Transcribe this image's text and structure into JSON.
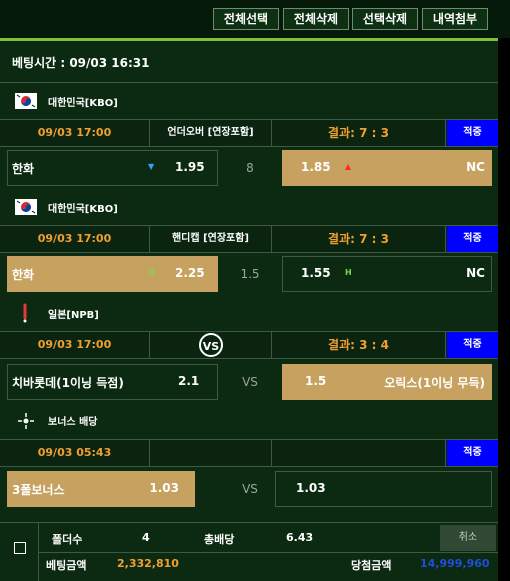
{
  "toolbar": {
    "select_all": "전체선택",
    "delete_all": "전체삭제",
    "delete_selected": "선택삭제",
    "attach_history": "내역첨부"
  },
  "bet_time": "베팅시간 : 09/03 16:31",
  "bets": [
    {
      "league": "대한민국[KBO]",
      "date": "09/03 17:00",
      "market": "언더오버 [연장포함]",
      "result": "결과: 7 : 3",
      "status": "적중",
      "home_team": "한화",
      "home_odds": "1.95",
      "home_mark": "▼",
      "mid": "8",
      "away_odds": "1.85",
      "away_mark": "▲",
      "away_team": "NC"
    },
    {
      "league": "대한민국[KBO]",
      "date": "09/03 17:00",
      "market": "핸디캡 [연장포함]",
      "result": "결과: 7 : 3",
      "status": "적중",
      "home_team": "한화",
      "home_odds": "2.25",
      "home_mark": "H",
      "mid": "1.5",
      "away_odds": "1.55",
      "away_mark": "H",
      "away_team": "NC"
    },
    {
      "league": "일본[NPB]",
      "date": "09/03 17:00",
      "market": "",
      "result": "결과: 3 : 4",
      "status": "적중",
      "home_team": "치바롯데(1이닝 득점)",
      "home_odds": "2.1",
      "mid": "VS",
      "away_odds": "1.5",
      "away_team": "오릭스(1이닝 무득)"
    },
    {
      "league": "보너스 배당",
      "date": "09/03 05:43",
      "market": "",
      "result": "",
      "status": "적중",
      "home_team": "3폴보너스",
      "home_odds": "1.03",
      "mid": "VS",
      "away_odds": "1.03",
      "away_team": ""
    }
  ],
  "footer": {
    "folder_label": "폴더수",
    "folder_value": "4",
    "total_odds_label": "총배당",
    "total_odds_value": "6.43",
    "cancel_label": "취소",
    "bet_amount_label": "베팅금액",
    "bet_amount_value": "2,332,810",
    "win_amount_label": "당첨금액",
    "win_amount_value": "14,999,960"
  },
  "colors": {
    "background": "#0c2a12",
    "accent_orange": "#f0a030",
    "status_blue": "#0000ff",
    "selected_gold": "#c7a15f",
    "win_amount_blue": "#1e4fd8",
    "odds_arrow_down": "#3aa0ff",
    "odds_arrow_up": "#ff2a2a",
    "handicap_green": "#7fd84a"
  }
}
